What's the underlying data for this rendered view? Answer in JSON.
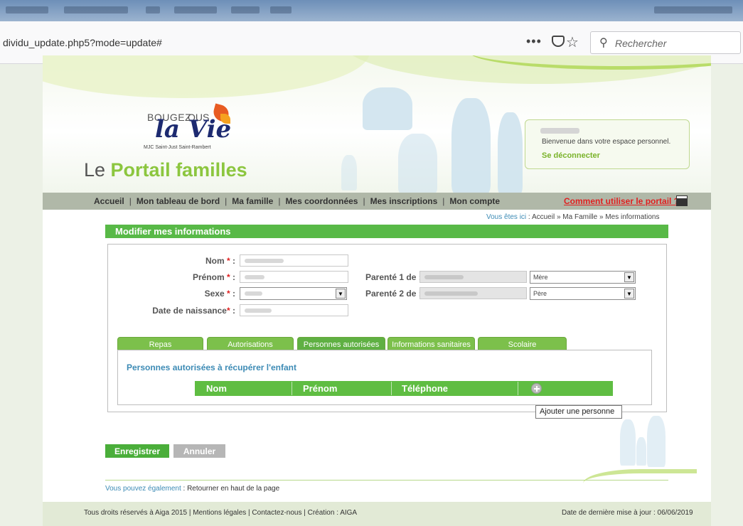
{
  "browser": {
    "url": "dividu_update.php5?mode=update#",
    "more_glyph": "•••",
    "star_glyph": "☆",
    "search_glyph": "⚲",
    "search_placeholder": "Rechercher",
    "icons": [
      "more-icon",
      "pocket-icon",
      "bookmark-star-icon",
      "search-icon"
    ]
  },
  "header": {
    "logo": {
      "bougez": "BOUGEZ",
      "vous": "OUS",
      "vie": "la Vie",
      "mjc": "MJC Saint-Just Saint-Rambert"
    },
    "portal_prefix": "Le ",
    "portal_bold": "Portail familles",
    "welcome_text": "Bienvenue dans votre espace personnel.",
    "logout": "Se déconnecter"
  },
  "nav": {
    "items": [
      "Accueil",
      "Mon tableau de bord",
      "Ma famille",
      "Mes coordonnées",
      "Mes inscriptions",
      "Mon compte"
    ],
    "separator": "|",
    "howto": "Comment utiliser le portail ?"
  },
  "breadcrumb": {
    "label": "Vous êtes ici",
    "path": " : Accueil » Ma Famille » Mes informations"
  },
  "section_title": "Modifier mes informations",
  "form": {
    "nom_label": "Nom",
    "prenom_label": "Prénom",
    "sexe_label": "Sexe",
    "naissance_label": "Date de naissance",
    "required_mark": "*",
    "colon": " :",
    "parent1_label": "Parenté 1 de :",
    "parent2_label": "Parenté 2 de :",
    "parent1_role": "Mère",
    "parent2_role": "Père",
    "arrow_glyph": "▼"
  },
  "tabs": [
    "Repas",
    "Autorisations",
    "Personnes autorisées",
    "Informations sanitaires",
    "Scolaire"
  ],
  "persons": {
    "title": "Personnes autorisées à récupérer l'enfant",
    "columns": [
      "Nom",
      "Prénom",
      "Téléphone"
    ],
    "add_tooltip": "Ajouter une personne"
  },
  "buttons": {
    "save": "Enregistrer",
    "cancel": "Annuler"
  },
  "footer": {
    "also_label": "Vous pouvez également",
    "also_link": " : Retourner en haut de la page",
    "copyright": "Tous droits réservés à Aiga 2015 | Mentions légales | Contactez-nous | Création : AIGA",
    "updated": "Date de dernière mise à jour : 06/06/2019"
  },
  "colors": {
    "accent_green": "#58b947",
    "link_blue": "#3d8bb5",
    "alert_red": "#e02020"
  }
}
